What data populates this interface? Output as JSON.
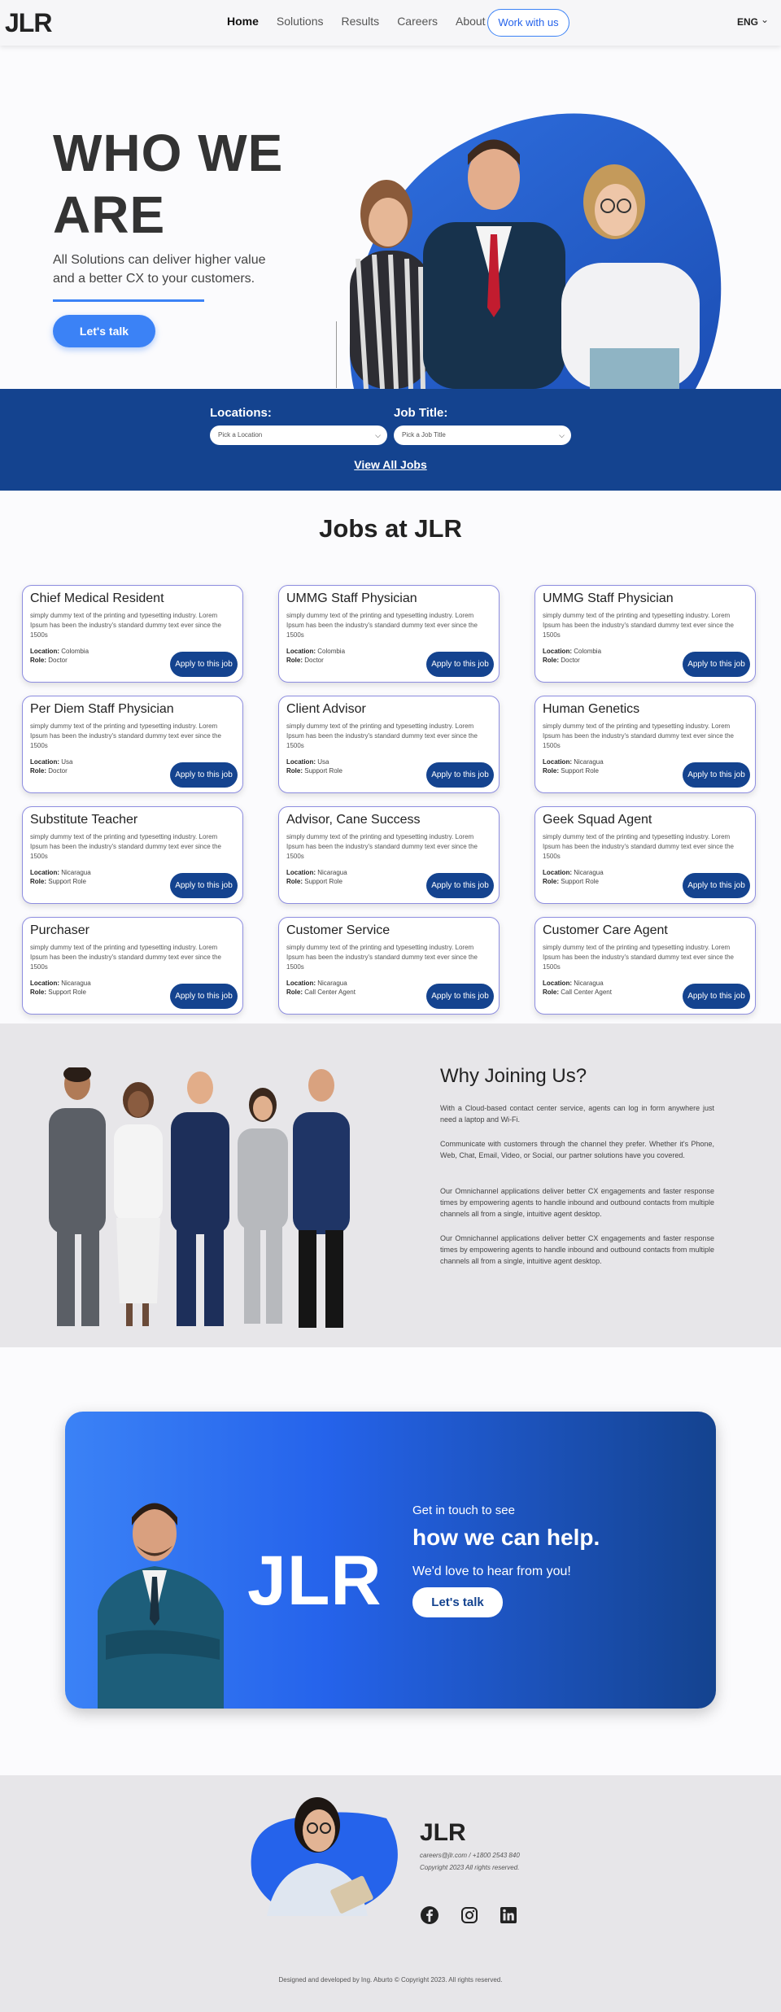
{
  "nav": {
    "logo": "JLR",
    "links": [
      "Home",
      "Solutions",
      "Results",
      "Careers",
      "About"
    ],
    "cta": "Work with us",
    "lang": "ENG"
  },
  "hero": {
    "title_line1": "WHO WE",
    "title_line2": "ARE",
    "subtitle": "All Solutions can deliver higher value and a better CX to your customers.",
    "button": "Let's talk"
  },
  "search": {
    "location_label": "Locations:",
    "location_placeholder": "Pick a Location",
    "job_label": "Job Title:",
    "job_placeholder": "Pick a Job Title",
    "view_all": "View All Jobs"
  },
  "jobs": {
    "title": "Jobs at JLR",
    "location_label": "Location:",
    "role_label": "Role:",
    "apply_label": "Apply to this job",
    "description": "simply dummy text of the printing and typesetting industry. Lorem Ipsum has been the industry's standard dummy text ever since the 1500s",
    "items": [
      {
        "title": "Chief Medical Resident",
        "location": "Colombia",
        "role": "Doctor"
      },
      {
        "title": "UMMG Staff Physician",
        "location": "Colombia",
        "role": "Doctor"
      },
      {
        "title": "UMMG Staff Physician",
        "location": "Colombia",
        "role": "Doctor"
      },
      {
        "title": "Per Diem Staff Physician",
        "location": "Usa",
        "role": "Doctor"
      },
      {
        "title": "Client Advisor",
        "location": "Usa",
        "role": "Support Role"
      },
      {
        "title": "Human Genetics",
        "location": "Nicaragua",
        "role": "Support Role"
      },
      {
        "title": "Substitute Teacher",
        "location": "Nicaragua",
        "role": "Support Role"
      },
      {
        "title": "Advisor, Cane Success",
        "location": "Nicaragua",
        "role": "Support Role"
      },
      {
        "title": "Geek Squad Agent",
        "location": "Nicaragua",
        "role": "Support Role"
      },
      {
        "title": "Purchaser",
        "location": "Nicaragua",
        "role": "Support Role"
      },
      {
        "title": "Customer Service",
        "location": "Nicaragua",
        "role": "Call Center Agent"
      },
      {
        "title": "Customer Care Agent",
        "location": "Nicaragua",
        "role": "Call Center Agent"
      }
    ]
  },
  "why": {
    "title": "Why Joining Us?",
    "paragraphs": [
      "With a Cloud-based contact center service, agents can log in form anywhere just need a laptop and Wi-Fi.",
      "Communicate with customers through the channel they prefer. Whether it's Phone, Web, Chat, Email, Video, or Social, our partner solutions have you covered.",
      "Our Omnichannel applications deliver better CX engagements and faster response times by empowering agents to handle inbound and outbound contacts from multiple channels all from a single, intuitive agent desktop.",
      "Our Omnichannel applications deliver better CX engagements and faster response times by empowering agents to handle inbound and outbound contacts from multiple channels all from a single, intuitive agent desktop."
    ]
  },
  "cta": {
    "logo": "JLR",
    "line1": "Get in touch to see",
    "line2": "how we can help.",
    "line3": "We'd love to hear from you!",
    "button": "Let's talk"
  },
  "footer": {
    "logo": "JLR",
    "contact": "careers@jlr.com / +1800 2543 840",
    "copyright": "Copyright 2023 All rights reserved.",
    "bottom": "Designed and developed by Ing. Aburto © Copyright 2023. All rights reserved.",
    "social_icons": [
      "facebook-icon",
      "instagram-icon",
      "linkedin-icon"
    ]
  },
  "colors": {
    "primary": "#3b82f6",
    "navy": "#14438f",
    "card_border": "#8d8de0",
    "section_gray": "#e7e6e9"
  }
}
